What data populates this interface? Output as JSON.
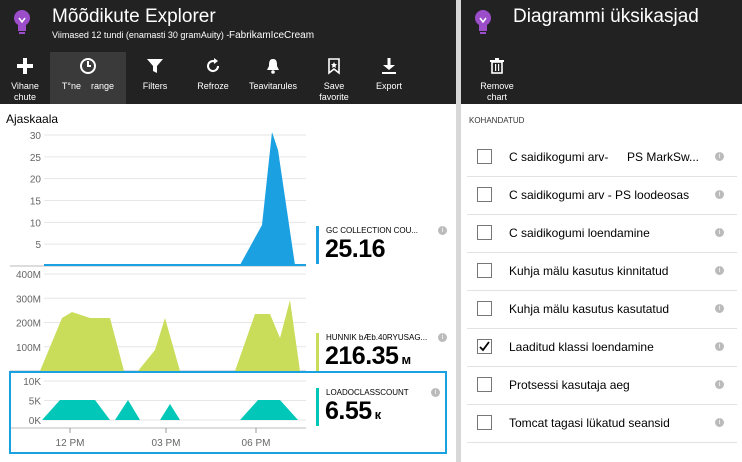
{
  "left": {
    "title": "Mõõdikute Explorer",
    "subtitle": "Viimased 12 tundi (enamasti 30 gramAuity) -",
    "resource": "FabrikamIceCream",
    "toolbar": [
      {
        "label": "Vihane chute",
        "icon": "plus-icon"
      },
      {
        "label": "T°ne    range",
        "icon": "clock-icon"
      },
      {
        "label": "Filters",
        "icon": "filter-icon"
      },
      {
        "label": "Refroze",
        "icon": "refresh-icon"
      },
      {
        "label": "Teavitarules",
        "icon": "bell-icon"
      },
      {
        "label": "Save favorite",
        "icon": "bookmark-icon"
      },
      {
        "label": "Export",
        "icon": "download-icon"
      }
    ],
    "section_title": "Ajaskaala",
    "x_ticks": [
      "12 PM",
      "03 PM",
      "06 PM"
    ],
    "charts": [
      {
        "name": "GC COLLECTION COU...",
        "value": "25.16",
        "unit": "",
        "color": "#1ba1e2",
        "y_ticks": [
          "30",
          "25",
          "20",
          "15",
          "10",
          "5"
        ],
        "ylim": [
          0,
          30
        ]
      },
      {
        "name": "HUNNIK bÆb.40RYUSAG...",
        "value": "216.35",
        "unit": "м",
        "color": "#c9dd5b",
        "y_ticks": [
          "400M",
          "300M",
          "200M",
          "100M"
        ],
        "ylim": [
          0,
          400
        ]
      },
      {
        "name": "LOADOCLASSCOUNT",
        "value": "6.55",
        "unit": "к",
        "color": "#00c7b7",
        "y_ticks": [
          "10K",
          "5K",
          "0K"
        ],
        "ylim": [
          0,
          12
        ]
      }
    ]
  },
  "right": {
    "title": "Diagrammi üksikasjad",
    "toolbar": [
      {
        "label": "Remove chart",
        "icon": "trash-icon"
      }
    ],
    "caption": "KOHANDATUD",
    "items": [
      {
        "label": "C saidikogumi arv-",
        "extra": "PS MarkSw...",
        "checked": false
      },
      {
        "label": "C saidikogumi arv - PS loodeosas",
        "checked": false
      },
      {
        "label": "C saidikogumi loendamine",
        "checked": false
      },
      {
        "label": "Kuhja mälu kasutus kinnitatud",
        "checked": false
      },
      {
        "label": "Kuhja mälu kasutus kasutatud",
        "checked": false
      },
      {
        "label": "Laaditud klassi loendamine",
        "checked": true
      },
      {
        "label": "Protsessi kasutaja aeg",
        "checked": false
      },
      {
        "label": "Tomcat tagasi lükatud seansid",
        "checked": false
      }
    ]
  }
}
